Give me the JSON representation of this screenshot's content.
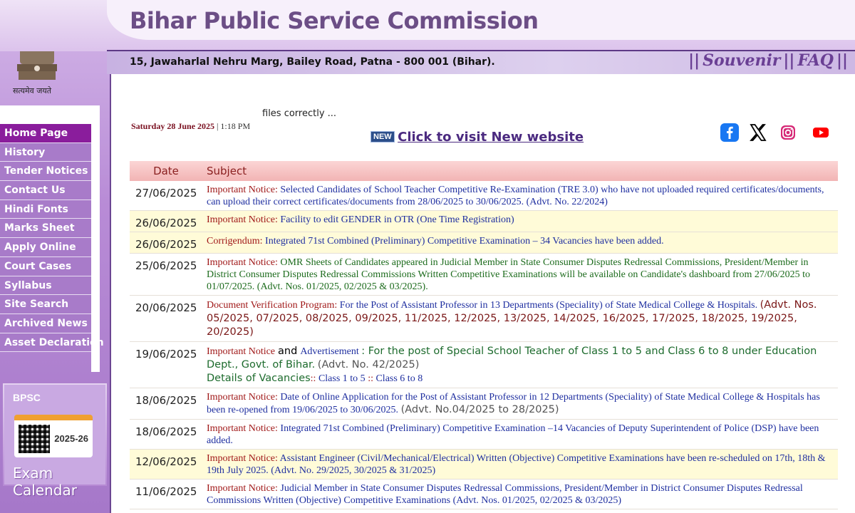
{
  "header": {
    "title": "Bihar Public Service Commission",
    "address": "15, Jawaharlal Nehru Marg, Bailey Road, Patna - 800 001 (Bihar).",
    "links": [
      "Souvenir",
      "FAQ"
    ],
    "emblem_motto": "सत्यमेव जयते"
  },
  "menu": {
    "items": [
      {
        "label": "Home Page",
        "active": true
      },
      {
        "label": "History"
      },
      {
        "label": "Tender Notices"
      },
      {
        "label": "Contact Us"
      },
      {
        "label": "Hindi Fonts"
      },
      {
        "label": "Marks Sheet"
      },
      {
        "label": "Apply Online"
      },
      {
        "label": "Court Cases"
      },
      {
        "label": "Syllabus"
      },
      {
        "label": "Site Search"
      },
      {
        "label": "Archived News"
      },
      {
        "label": "Asset Declaration"
      }
    ]
  },
  "exam_calendar": {
    "brand": "BPSC",
    "year": "2025-26",
    "label": "Exam Calendar"
  },
  "top": {
    "loading_text": "files correctly ...",
    "date": "Saturday 28 June 2025",
    "time": "| 1:18 PM",
    "new_badge": "NEW",
    "new_site_link": "Click to visit New website"
  },
  "socials": [
    {
      "icon": "facebook-icon",
      "color": "#1877f2"
    },
    {
      "icon": "x-icon",
      "color": "#000000"
    },
    {
      "icon": "instagram-icon",
      "color": "#e1306c"
    },
    {
      "icon": "youtube-icon",
      "color": "#ff0000"
    }
  ],
  "table": {
    "headers": {
      "date": "Date",
      "subject": "Subject"
    },
    "rows": [
      {
        "date": "27/06/2025",
        "kind": "Important Notice:",
        "text": "Selected Candidates of School Teacher Competitive Re-Examination (TRE 3.0) who have not uploaded required certificates/documents, can upload their correct certificates/documents from 28/06/2025 to 30/06/2025. (Advt. No. 22/2024)"
      },
      {
        "date": "26/06/2025",
        "kind": "Important Notice:",
        "text": "Facility to edit GENDER in OTR (One Time Registration)"
      },
      {
        "date": "26/06/2025",
        "kind": "Corrigendum:",
        "text": "Integrated 71st Combined (Preliminary) Competitive Examination – 34 Vacancies have been added."
      },
      {
        "date": "25/06/2025",
        "kind": "Important Notice:",
        "text": "OMR Sheets of Candidates appeared in Judicial Member in State Consumer Disputes Redressal Commissions, President/Member in District Consumer Disputes Redressal Commissions Written Competitive Examinations will be available on Candidate's dashboard from 27/06/2025 to 01/07/2025. (Advt. Nos. 01/2025, 02/2025 & 03/2025)."
      },
      {
        "date": "20/06/2025",
        "kind": "Document Verification Program:",
        "text": "For the Post of Assistant Professor in 13 Departments (Speciality) of State Medical College & Hospitals.",
        "extra": "(Advt. Nos. 05/2025, 07/2025, 08/2025, 09/2025, 11/2025, 12/2025, 13/2025, 14/2025, 16/2025, 17/2025, 18/2025, 19/2025, 20/2025)"
      },
      {
        "date": "19/06/2025",
        "kind": "Important Notice",
        "and": "and",
        "kind2": "Advertisement",
        "text": ": For the post of Special School Teacher of Class 1 to 5 and Class 6 to 8 under Education Dept., Govt. of Bihar.",
        "extra": "(Advt. No. 42/2025)",
        "details_label": "Details of Vacancies",
        "sep": "::",
        "link1": "Class 1 to 5",
        "link2": "Class 6 to 8"
      },
      {
        "date": "18/06/2025",
        "kind": "Important Notice:",
        "text": "Date of Online Application for the Post of Assistant Professor in 12 Departments (Speciality) of State Medical College & Hospitals has been re-opened from 19/06/2025 to 30/06/2025.",
        "extra": "(Advt. No.04/2025 to 28/2025)"
      },
      {
        "date": "18/06/2025",
        "kind": "Important Notice:",
        "text": "Integrated 71st Combined (Preliminary) Competitive Examination –14 Vacancies of Deputy Superintendent of Police (DSP) have been added."
      },
      {
        "date": "12/06/2025",
        "kind": "Important Notice:",
        "text": "Assistant Engineer (Civil/Mechanical/Electrical) Written (Objective) Competitive Examinations have been re-scheduled on 17th, 18th & 19th July 2025. (Advt. No. 29/2025, 30/2025 & 31/2025)"
      },
      {
        "date": "11/06/2025",
        "kind": "Important Notice:",
        "text": "Judicial Member in State Consumer Disputes Redressal Commissions, President/Member in District Consumer Disputes Redressal Commissions Written (Objective) Competitive Examinations (Advt. Nos. 01/2025, 02/2025 & 03/2025)"
      }
    ]
  }
}
